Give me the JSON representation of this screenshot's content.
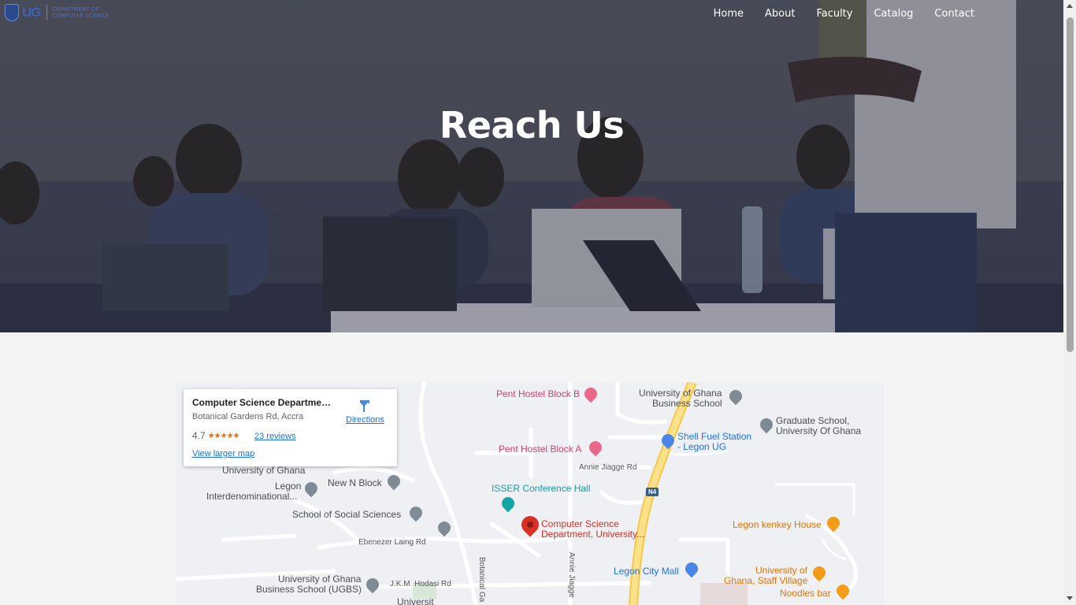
{
  "nav": {
    "logo_abbr": "UG",
    "logo_line1": "DEPARTMENT OF",
    "logo_line2": "COMPUTER SCIENCE",
    "items": [
      {
        "label": "Home"
      },
      {
        "label": "About"
      },
      {
        "label": "Faculty"
      },
      {
        "label": "Catalog"
      },
      {
        "label": "Contact"
      }
    ]
  },
  "hero": {
    "title": "Reach Us"
  },
  "map": {
    "card": {
      "name": "Computer Science Departmen...",
      "address": "Botanical Gardens Rd, Accra",
      "rating": "4.7",
      "stars": "★★★★★",
      "reviews": "23 reviews",
      "view_larger": "View larger map",
      "directions": "Directions"
    },
    "places": {
      "pent_b": "Pent Hostel Block B",
      "pent_a": "Pent Hostel Block A",
      "ugbs_1": "University of Ghana",
      "ugbs_2": "Business School",
      "grad_1": "Graduate School,",
      "grad_2": "University Of Ghana",
      "shell_1": "Shell Fuel Station",
      "shell_2": "- Legon UG",
      "annie_jiagge": "Annie Jiagge Rd",
      "isser": "ISSER Conference Hall",
      "n4": "N4",
      "uog_partial": "University of Ghana",
      "new_n_block": "New N Block",
      "legon_1": "Legon",
      "legon_2": "Interdenominational...",
      "social": "School of Social Sciences",
      "cs_1": "Computer Science",
      "cs_2": "Department, University...",
      "kenkey": "Legon kenkey House",
      "ebenezer": "Ebenezer Laing Rd",
      "legon_mall": "Legon City Mall",
      "staff_1": "University of",
      "staff_2": "Ghana, Staff Village",
      "noodles": "Noodles bar",
      "ugbs2_1": "University of Ghana",
      "ugbs2_2": "Business School (UGBS)",
      "hodasi": "J.K.M. Hodasi Rd",
      "botanical": "Botanical Ga",
      "annie_v": "Annie Jiagge",
      "univ_bottom": "Universit"
    }
  }
}
